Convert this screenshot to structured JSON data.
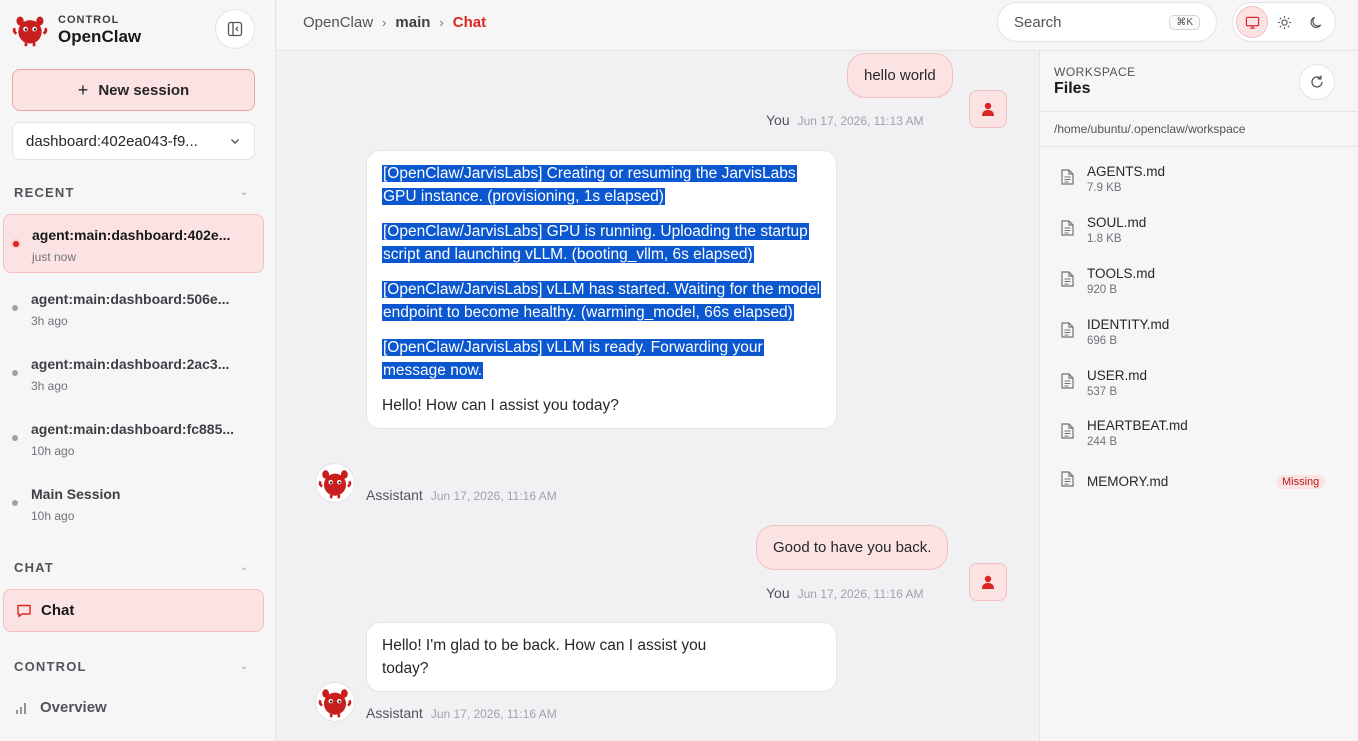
{
  "sidebar": {
    "brand_sub": "CONTROL",
    "brand_title": "OpenClaw",
    "new_session_label": "New session",
    "session_select_value": "dashboard:402ea043-f9...",
    "recent_label": "RECENT",
    "recent": [
      {
        "title": "agent:main:dashboard:402e...",
        "time": "just now",
        "active": true
      },
      {
        "title": "agent:main:dashboard:506e...",
        "time": "3h ago"
      },
      {
        "title": "agent:main:dashboard:2ac3...",
        "time": "3h ago"
      },
      {
        "title": "agent:main:dashboard:fc885...",
        "time": "10h ago"
      },
      {
        "title": "Main Session",
        "time": "10h ago"
      }
    ],
    "chat_label": "CHAT",
    "chat_item": "Chat",
    "control_label": "CONTROL",
    "overview_item": "Overview"
  },
  "header": {
    "breadcrumb": [
      "OpenClaw",
      "main",
      "Chat"
    ],
    "search_placeholder": "Search",
    "search_shortcut": "⌘K"
  },
  "chat": {
    "messages": [
      {
        "role": "user",
        "text": "hello world",
        "author": "You",
        "time": "Jun 17, 2026, 11:13 AM"
      },
      {
        "role": "assistant",
        "author": "Assistant",
        "time": "Jun 17, 2026, 11:16 AM",
        "paragraphs": [
          "[OpenClaw/JarvisLabs] Creating or resuming the JarvisLabs GPU instance. (provisioning, 1s elapsed)",
          "[OpenClaw/JarvisLabs] GPU is running. Uploading the startup script and launching vLLM. (booting_vllm, 6s elapsed)",
          "[OpenClaw/JarvisLabs] vLLM has started. Waiting for the model endpoint to become healthy. (warming_model, 66s elapsed)",
          "[OpenClaw/JarvisLabs] vLLM is ready. Forwarding your message now.",
          "Hello! How can I assist you today?"
        ]
      },
      {
        "role": "user",
        "text": "Good to have you back.",
        "author": "You",
        "time": "Jun 17, 2026, 11:16 AM"
      },
      {
        "role": "assistant",
        "author": "Assistant",
        "time": "Jun 17, 2026, 11:16 AM",
        "paragraphs": [
          "Hello! I'm glad to be back. How can I assist you today?"
        ]
      }
    ]
  },
  "files": {
    "sub": "WORKSPACE",
    "title": "Files",
    "path": "/home/ubuntu/.openclaw/workspace",
    "items": [
      {
        "name": "AGENTS.md",
        "size": "7.9 KB"
      },
      {
        "name": "SOUL.md",
        "size": "1.8 KB"
      },
      {
        "name": "TOOLS.md",
        "size": "920 B"
      },
      {
        "name": "IDENTITY.md",
        "size": "696 B"
      },
      {
        "name": "USER.md",
        "size": "537 B"
      },
      {
        "name": "HEARTBEAT.md",
        "size": "244 B"
      },
      {
        "name": "MEMORY.md",
        "badge": "Missing"
      }
    ]
  },
  "colors": {
    "accent": "#dc2626",
    "accent_soft": "#fbe3e3",
    "selection": "#0b57d0"
  }
}
